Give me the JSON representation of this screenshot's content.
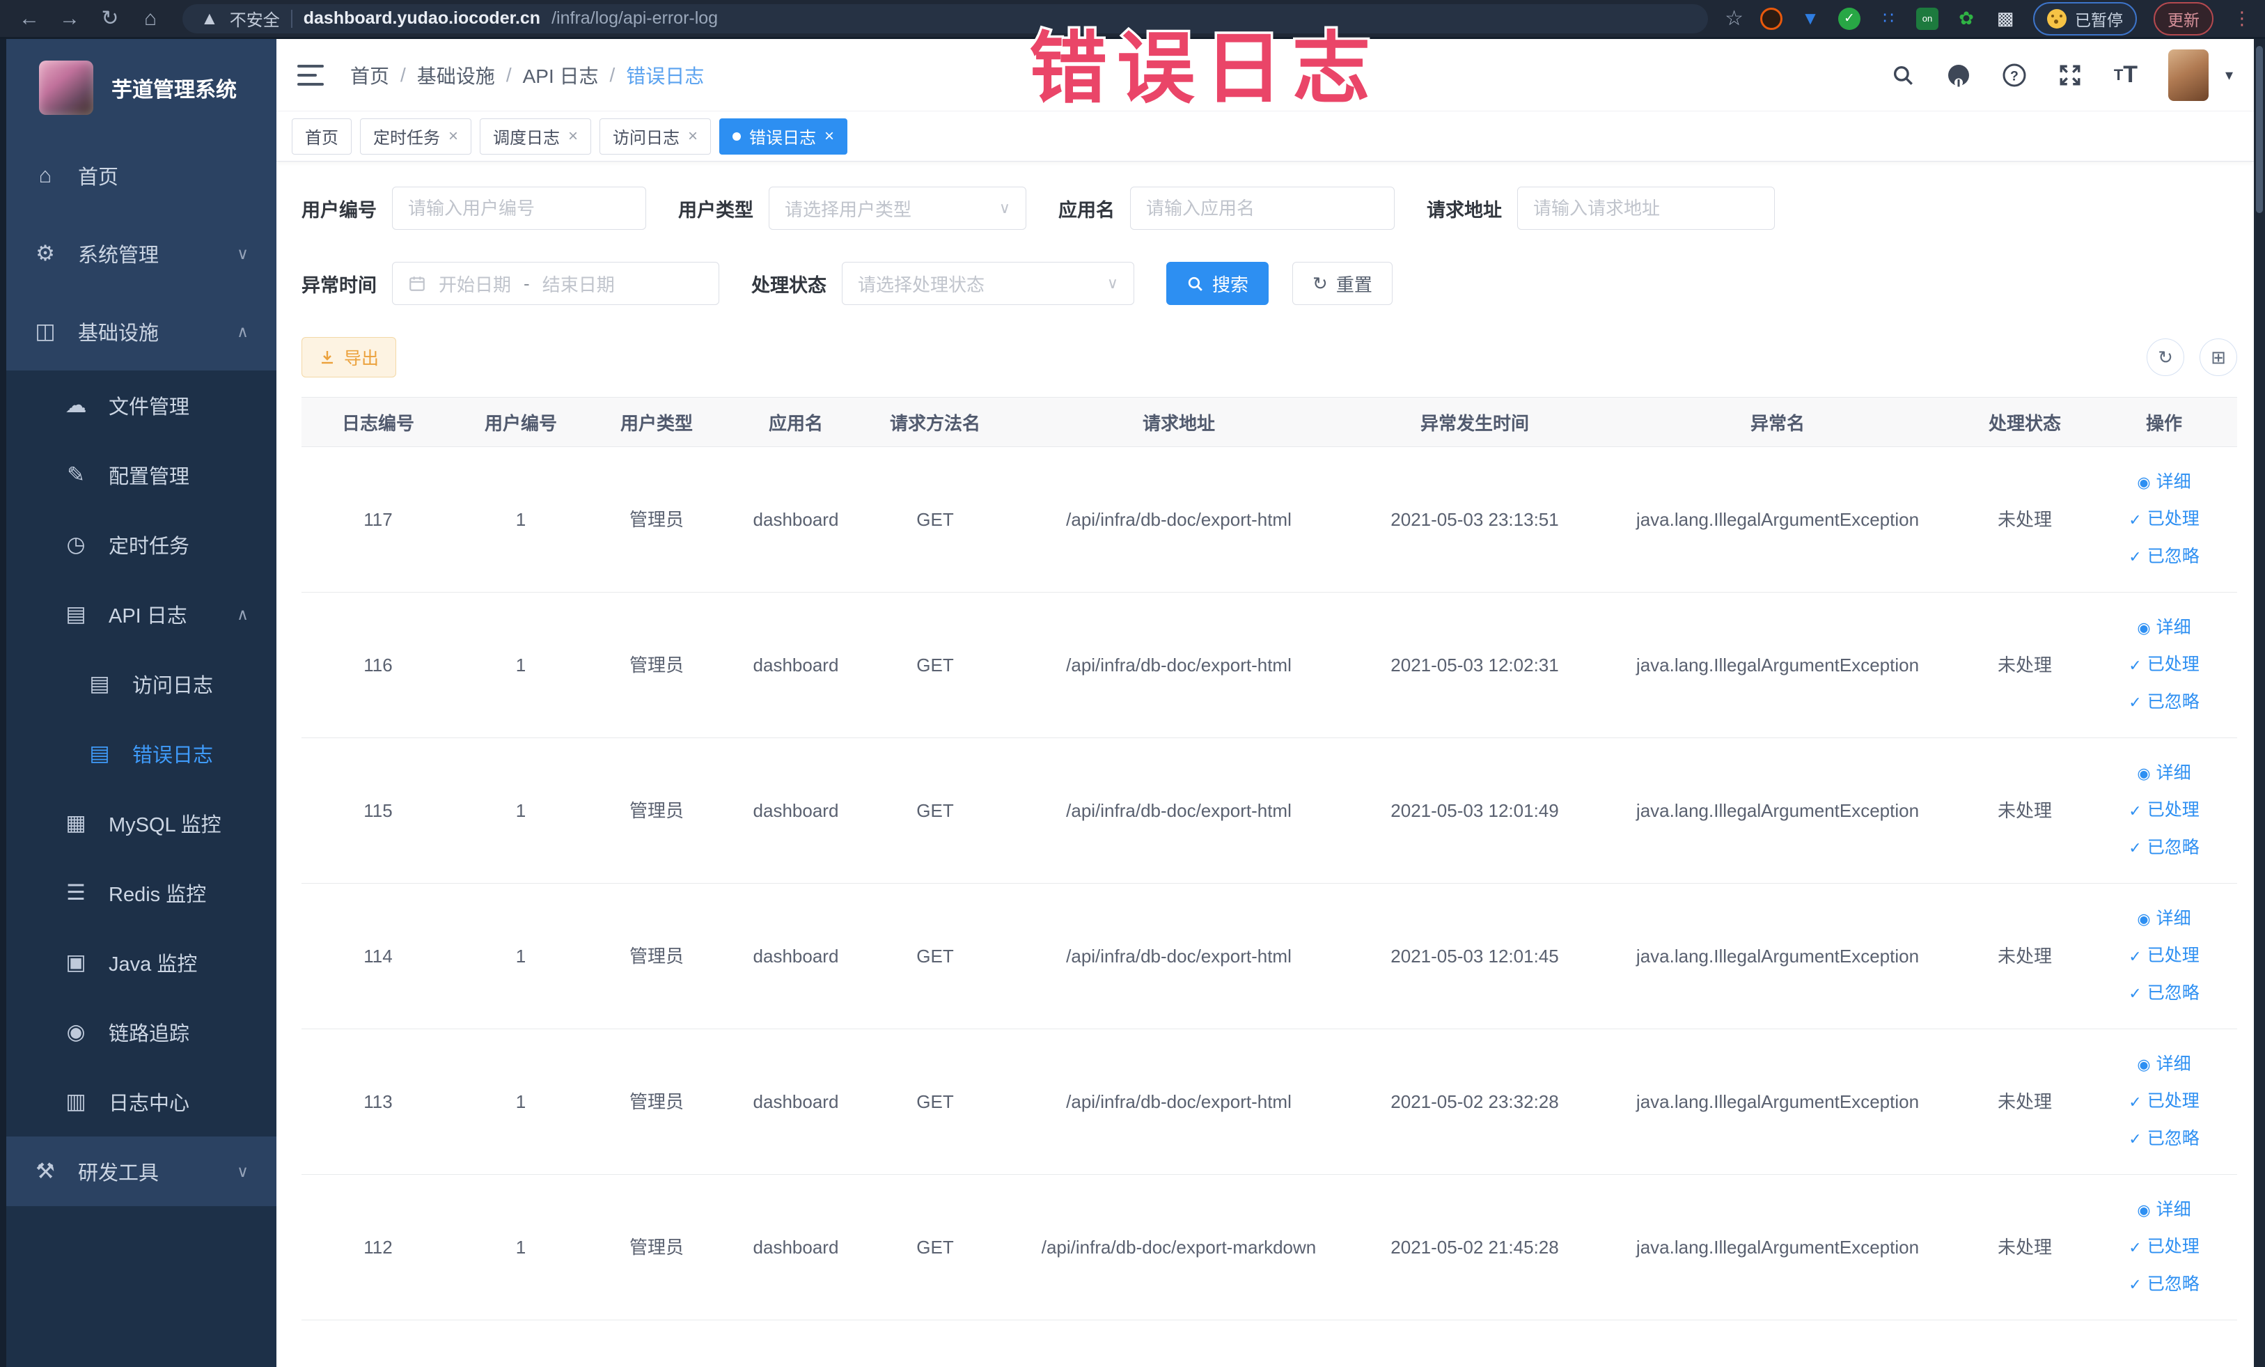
{
  "browser": {
    "security_label": "不安全",
    "url_domain": "dashboard.yudao.iocoder.cn",
    "url_path": "/infra/log/api-error-log",
    "paused_badge": "已暂停",
    "update_button": "更新"
  },
  "overlay": {
    "text": "错误日志"
  },
  "sidebar": {
    "logo_title": "芋道管理系统",
    "top_items": [
      {
        "label": "首页",
        "icon": "home-icon",
        "level": 1
      },
      {
        "label": "系统管理",
        "icon": "gear-icon",
        "level": 1,
        "chevron": "down"
      },
      {
        "label": "基础设施",
        "icon": "infrastructure-icon",
        "level": 1,
        "chevron": "up"
      }
    ],
    "sub_items": [
      {
        "label": "文件管理",
        "icon": "cloud-upload-icon",
        "level": 2
      },
      {
        "label": "配置管理",
        "icon": "config-edit-icon",
        "level": 2
      },
      {
        "label": "定时任务",
        "icon": "timer-icon",
        "level": 2
      },
      {
        "label": "API 日志",
        "icon": "api-log-icon",
        "level": 2,
        "chevron": "up"
      },
      {
        "label": "访问日志",
        "icon": "access-log-icon",
        "level": 3
      },
      {
        "label": "错误日志",
        "icon": "error-log-icon",
        "level": 3,
        "active": true
      },
      {
        "label": "MySQL 监控",
        "icon": "mysql-monitor-icon",
        "level": 2
      },
      {
        "label": "Redis 监控",
        "icon": "redis-monitor-icon",
        "level": 2
      },
      {
        "label": "Java 监控",
        "icon": "java-monitor-icon",
        "level": 2
      },
      {
        "label": "链路追踪",
        "icon": "trace-icon",
        "level": 2
      },
      {
        "label": "日志中心",
        "icon": "log-center-icon",
        "level": 2
      }
    ],
    "bottom_items": [
      {
        "label": "研发工具",
        "icon": "dev-tools-icon",
        "level": 1,
        "chevron": "down"
      }
    ]
  },
  "header": {
    "breadcrumb": [
      "首页",
      "基础设施",
      "API 日志",
      "错误日志"
    ]
  },
  "tabs": [
    {
      "label": "首页",
      "closable": false,
      "active": false
    },
    {
      "label": "定时任务",
      "closable": true,
      "active": false
    },
    {
      "label": "调度日志",
      "closable": true,
      "active": false
    },
    {
      "label": "访问日志",
      "closable": true,
      "active": false
    },
    {
      "label": "错误日志",
      "closable": true,
      "active": true
    }
  ],
  "filters": {
    "user_id": {
      "label": "用户编号",
      "placeholder": "请输入用户编号"
    },
    "user_type": {
      "label": "用户类型",
      "placeholder": "请选择用户类型"
    },
    "app_name": {
      "label": "应用名",
      "placeholder": "请输入应用名"
    },
    "request_url": {
      "label": "请求地址",
      "placeholder": "请输入请求地址"
    },
    "exception_time": {
      "label": "异常时间",
      "start_placeholder": "开始日期",
      "separator": "-",
      "end_placeholder": "结束日期"
    },
    "process_status": {
      "label": "处理状态",
      "placeholder": "请选择处理状态"
    },
    "search_label": "搜索",
    "reset_label": "重置"
  },
  "toolbar": {
    "export_label": "导出"
  },
  "table": {
    "columns": [
      "日志编号",
      "用户编号",
      "用户类型",
      "应用名",
      "请求方法名",
      "请求地址",
      "异常发生时间",
      "异常名",
      "处理状态",
      "操作"
    ],
    "actions": {
      "detail": "详细",
      "processed": "已处理",
      "ignored": "已忽略"
    },
    "rows": [
      {
        "id": "117",
        "user_id": "1",
        "user_type": "管理员",
        "app": "dashboard",
        "method": "GET",
        "url": "/api/infra/db-doc/export-html",
        "time": "2021-05-03 23:13:51",
        "exception": "java.lang.IllegalArgumentException",
        "status": "未处理"
      },
      {
        "id": "116",
        "user_id": "1",
        "user_type": "管理员",
        "app": "dashboard",
        "method": "GET",
        "url": "/api/infra/db-doc/export-html",
        "time": "2021-05-03 12:02:31",
        "exception": "java.lang.IllegalArgumentException",
        "status": "未处理"
      },
      {
        "id": "115",
        "user_id": "1",
        "user_type": "管理员",
        "app": "dashboard",
        "method": "GET",
        "url": "/api/infra/db-doc/export-html",
        "time": "2021-05-03 12:01:49",
        "exception": "java.lang.IllegalArgumentException",
        "status": "未处理"
      },
      {
        "id": "114",
        "user_id": "1",
        "user_type": "管理员",
        "app": "dashboard",
        "method": "GET",
        "url": "/api/infra/db-doc/export-html",
        "time": "2021-05-03 12:01:45",
        "exception": "java.lang.IllegalArgumentException",
        "status": "未处理"
      },
      {
        "id": "113",
        "user_id": "1",
        "user_type": "管理员",
        "app": "dashboard",
        "method": "GET",
        "url": "/api/infra/db-doc/export-html",
        "time": "2021-05-02 23:32:28",
        "exception": "java.lang.IllegalArgumentException",
        "status": "未处理"
      },
      {
        "id": "112",
        "user_id": "1",
        "user_type": "管理员",
        "app": "dashboard",
        "method": "GET",
        "url": "/api/infra/db-doc/export-markdown",
        "time": "2021-05-02 21:45:28",
        "exception": "java.lang.IllegalArgumentException",
        "status": "未处理"
      }
    ]
  }
}
